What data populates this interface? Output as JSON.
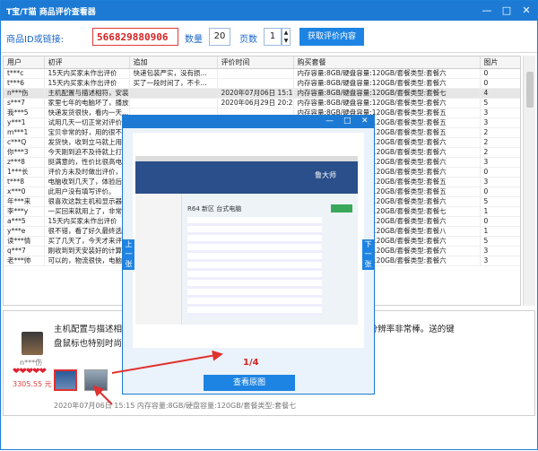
{
  "window": {
    "title": "T宝/T猫 商品评价查看器",
    "accent": "#1c7ad4"
  },
  "toolbar": {
    "id_label": "商品ID或链接:",
    "id_value": "566829880906",
    "qty_label": "数量",
    "qty_value": "20",
    "pages_label": "页数",
    "pages_value": "1",
    "fetch_button": "获取评价内容"
  },
  "table": {
    "headers": [
      "用户",
      "初评",
      "追加",
      "评价时间",
      "购买套餐",
      "图片"
    ],
    "rows": [
      [
        "t***c",
        "15天内买家未作出评价",
        "快递包装严实，没有损...",
        "",
        "内存容量:8GB/硬盘容量:120GB/套餐类型:套餐六",
        "0"
      ],
      [
        "t***6",
        "15天内买家未作出评价",
        "买了一段时间了，不卡...",
        "",
        "内存容量:8GB/硬盘容量:120GB/套餐类型:套餐六",
        "0"
      ],
      [
        "n***伤",
        "主机配置与描述相符，安装完整...",
        "",
        "2020年07月06日 15:15",
        "内存容量:8GB/硬盘容量:120GB/套餐类型:套餐七",
        "4"
      ],
      [
        "s***7",
        "家里七年的电脑坏了，播放大修...",
        "",
        "2020年06月29日 20:23",
        "内存容量:8GB/硬盘容量:120GB/套餐类型:套餐六",
        "5"
      ],
      [
        "我***5",
        "快递发货很快，看内一天...",
        "",
        "",
        "内存容量:8GB/硬盘容量:120GB/套餐类型:套餐五",
        "3"
      ],
      [
        "y***1",
        "试用几天一切正常对评价...",
        "",
        "",
        "内存容量:8GB/硬盘容量:120GB/套餐类型:套餐五",
        "3"
      ],
      [
        "m***1",
        "宝贝非常的好，用的很不...",
        "",
        "",
        "内存容量:8GB/硬盘容量:120GB/套餐类型:套餐五",
        "2"
      ],
      [
        "c***Q",
        "发货快，收到立马就上用...",
        "",
        "",
        "内存容量:8GB/硬盘容量:120GB/套餐类型:套餐六",
        "2"
      ],
      [
        "你***3",
        "今天刚到迫不及待就上打...",
        "",
        "",
        "内存容量:8GB/硬盘容量:120GB/套餐类型:套餐六",
        "2"
      ],
      [
        "z***8",
        "挺满意的，性价比很高电...",
        "",
        "",
        "内存容量:8GB/硬盘容量:120GB/套餐类型:套餐六",
        "3"
      ],
      [
        "1***长",
        "评价方未及时做出评价，系...",
        "",
        "",
        "内存容量:8GB/硬盘容量:120GB/套餐类型:套餐六",
        "0"
      ],
      [
        "t***8",
        "电脑收到几天了，体验后...",
        "",
        "",
        "内存容量:8GB/硬盘容量:120GB/套餐类型:套餐五",
        "3"
      ],
      [
        "x***0",
        "此用户没有填写评价。",
        "",
        "",
        "内存容量:8GB/硬盘容量:120GB/套餐类型:套餐五",
        "0"
      ],
      [
        "年***来",
        "很喜欢这款主机和显示器...",
        "",
        "",
        "内存容量:8GB/硬盘容量:120GB/套餐类型:套餐六",
        "5"
      ],
      [
        "李***y",
        "一买回来就用上了，非常...",
        "",
        "",
        "内存容量:8GB/硬盘容量:120GB/套餐类型:套餐七",
        "1"
      ],
      [
        "a***5",
        "15天内买家未作出评价",
        "",
        "",
        "内存容量:8GB/硬盘容量:120GB/套餐类型:套餐六",
        "0"
      ],
      [
        "y***e",
        "很不错，看了好久最终选...",
        "",
        "",
        "内存容量:8GB/硬盘容量:120GB/套餐类型:套餐八",
        "1"
      ],
      [
        "读***情",
        "买了几天了，今天才来评...",
        "",
        "",
        "内存容量:8GB/硬盘容量:120GB/套餐类型:套餐六",
        "5"
      ],
      [
        "q***7",
        "刚收到到天安装好的计算...",
        "",
        "",
        "内存容量:8GB/硬盘容量:120GB/套餐类型:套餐六",
        "3"
      ],
      [
        "老***帅",
        "可以的，物流很快，电脑...",
        "",
        "",
        "内存容量:8GB/硬盘容量:120GB/套餐类型:套餐六",
        "3"
      ]
    ]
  },
  "detail": {
    "text_line1": "主机配置与描述相符                                                               思普弧形显示器，分辨率非常棒。送的键",
    "text_line2": "盘鼠标也特别时尚，",
    "username": "n***伤",
    "price": "3305.55 元",
    "footer": "2020年07月06日 15:15  内存容量:8GB/硬盘容量:120GB/套餐类型:套餐七"
  },
  "popup": {
    "prev_label": "上一张",
    "next_label": "下一张",
    "pager": "1/4",
    "view_original": "查看原图",
    "screen_brand": "鲁大师",
    "screen_title": "R64 新区 台式电脑"
  }
}
